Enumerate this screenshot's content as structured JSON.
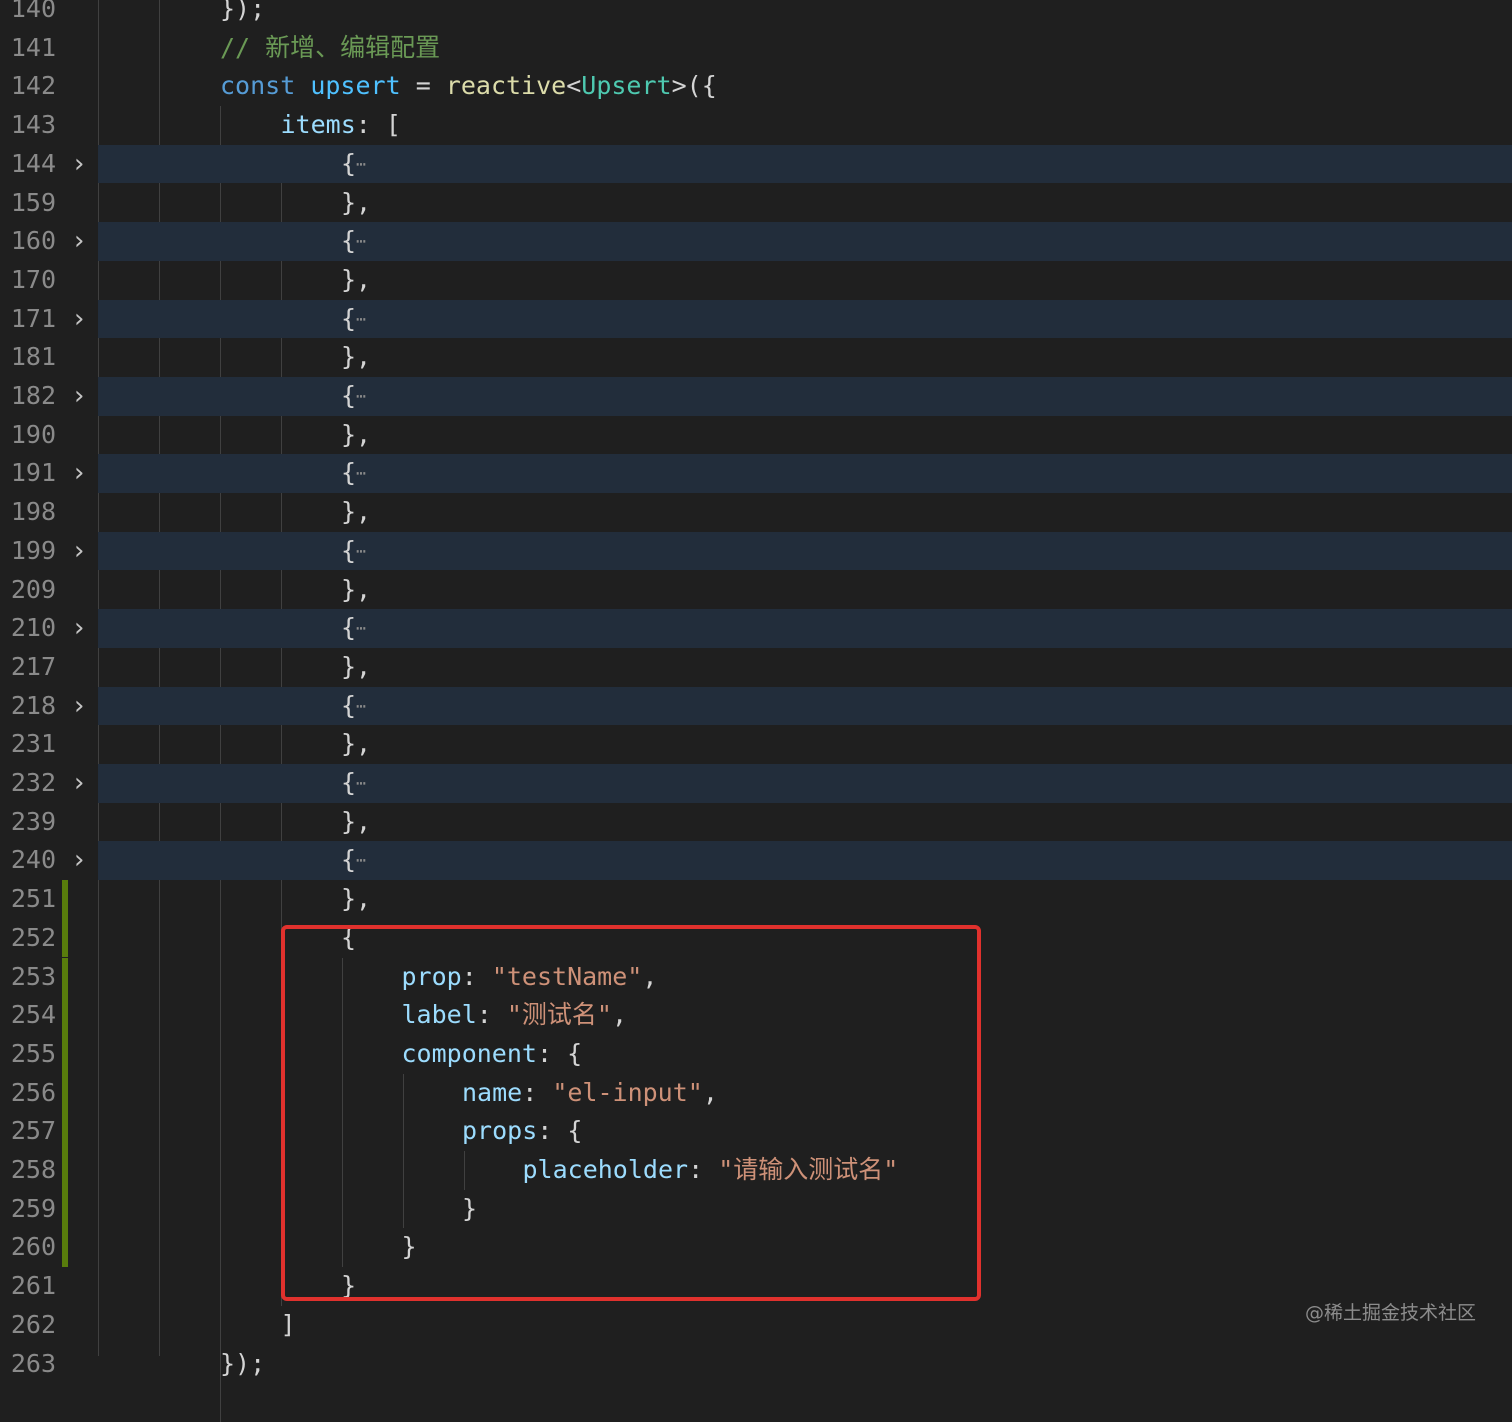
{
  "editor": {
    "lines": [
      {
        "num": "140",
        "indent": 0,
        "folded": false,
        "modified": false,
        "tokens": [
          {
            "t": "});",
            "c": "punc"
          }
        ]
      },
      {
        "num": "141",
        "indent": 0,
        "folded": false,
        "modified": false,
        "tokens": [
          {
            "t": "// 新增、编辑配置",
            "c": "comment"
          }
        ]
      },
      {
        "num": "142",
        "indent": 0,
        "folded": false,
        "modified": false,
        "tokens": [
          {
            "t": "const",
            "c": "kw"
          },
          {
            "t": " ",
            "c": "punc"
          },
          {
            "t": "upsert",
            "c": "var"
          },
          {
            "t": " = ",
            "c": "punc"
          },
          {
            "t": "reactive",
            "c": "fn"
          },
          {
            "t": "<",
            "c": "punc"
          },
          {
            "t": "Upsert",
            "c": "type"
          },
          {
            "t": ">({",
            "c": "punc"
          }
        ]
      },
      {
        "num": "143",
        "indent": 1,
        "folded": false,
        "modified": false,
        "tokens": [
          {
            "t": "items",
            "c": "prop"
          },
          {
            "t": ": [",
            "c": "punc"
          }
        ]
      },
      {
        "num": "144",
        "indent": 2,
        "folded": true,
        "modified": false,
        "tokens": [
          {
            "t": "{",
            "c": "punc"
          },
          {
            "t": "⋯",
            "c": "dots"
          }
        ]
      },
      {
        "num": "159",
        "indent": 2,
        "folded": false,
        "modified": false,
        "tokens": [
          {
            "t": "},",
            "c": "punc"
          }
        ]
      },
      {
        "num": "160",
        "indent": 2,
        "folded": true,
        "modified": false,
        "tokens": [
          {
            "t": "{",
            "c": "punc"
          },
          {
            "t": "⋯",
            "c": "dots"
          }
        ]
      },
      {
        "num": "170",
        "indent": 2,
        "folded": false,
        "modified": false,
        "tokens": [
          {
            "t": "},",
            "c": "punc"
          }
        ]
      },
      {
        "num": "171",
        "indent": 2,
        "folded": true,
        "modified": false,
        "tokens": [
          {
            "t": "{",
            "c": "punc"
          },
          {
            "t": "⋯",
            "c": "dots"
          }
        ]
      },
      {
        "num": "181",
        "indent": 2,
        "folded": false,
        "modified": false,
        "tokens": [
          {
            "t": "},",
            "c": "punc"
          }
        ]
      },
      {
        "num": "182",
        "indent": 2,
        "folded": true,
        "modified": false,
        "tokens": [
          {
            "t": "{",
            "c": "punc"
          },
          {
            "t": "⋯",
            "c": "dots"
          }
        ]
      },
      {
        "num": "190",
        "indent": 2,
        "folded": false,
        "modified": false,
        "tokens": [
          {
            "t": "},",
            "c": "punc"
          }
        ]
      },
      {
        "num": "191",
        "indent": 2,
        "folded": true,
        "modified": false,
        "tokens": [
          {
            "t": "{",
            "c": "punc"
          },
          {
            "t": "⋯",
            "c": "dots"
          }
        ]
      },
      {
        "num": "198",
        "indent": 2,
        "folded": false,
        "modified": false,
        "tokens": [
          {
            "t": "},",
            "c": "punc"
          }
        ]
      },
      {
        "num": "199",
        "indent": 2,
        "folded": true,
        "modified": false,
        "tokens": [
          {
            "t": "{",
            "c": "punc"
          },
          {
            "t": "⋯",
            "c": "dots"
          }
        ]
      },
      {
        "num": "209",
        "indent": 2,
        "folded": false,
        "modified": false,
        "tokens": [
          {
            "t": "},",
            "c": "punc"
          }
        ]
      },
      {
        "num": "210",
        "indent": 2,
        "folded": true,
        "modified": false,
        "tokens": [
          {
            "t": "{",
            "c": "punc"
          },
          {
            "t": "⋯",
            "c": "dots"
          }
        ]
      },
      {
        "num": "217",
        "indent": 2,
        "folded": false,
        "modified": false,
        "tokens": [
          {
            "t": "},",
            "c": "punc"
          }
        ]
      },
      {
        "num": "218",
        "indent": 2,
        "folded": true,
        "modified": false,
        "tokens": [
          {
            "t": "{",
            "c": "punc"
          },
          {
            "t": "⋯",
            "c": "dots"
          }
        ]
      },
      {
        "num": "231",
        "indent": 2,
        "folded": false,
        "modified": false,
        "tokens": [
          {
            "t": "},",
            "c": "punc"
          }
        ]
      },
      {
        "num": "232",
        "indent": 2,
        "folded": true,
        "modified": false,
        "tokens": [
          {
            "t": "{",
            "c": "punc"
          },
          {
            "t": "⋯",
            "c": "dots"
          }
        ]
      },
      {
        "num": "239",
        "indent": 2,
        "folded": false,
        "modified": false,
        "tokens": [
          {
            "t": "},",
            "c": "punc"
          }
        ]
      },
      {
        "num": "240",
        "indent": 2,
        "folded": true,
        "modified": false,
        "tokens": [
          {
            "t": "{",
            "c": "punc"
          },
          {
            "t": "⋯",
            "c": "dots"
          }
        ]
      },
      {
        "num": "251",
        "indent": 2,
        "folded": false,
        "modified": true,
        "tokens": [
          {
            "t": "},",
            "c": "punc"
          }
        ]
      },
      {
        "num": "252",
        "indent": 2,
        "folded": false,
        "modified": true,
        "tokens": [
          {
            "t": "{",
            "c": "punc"
          }
        ]
      },
      {
        "num": "253",
        "indent": 3,
        "folded": false,
        "modified": true,
        "tokens": [
          {
            "t": "prop",
            "c": "prop"
          },
          {
            "t": ": ",
            "c": "punc"
          },
          {
            "t": "\"testName\"",
            "c": "str"
          },
          {
            "t": ",",
            "c": "punc"
          }
        ]
      },
      {
        "num": "254",
        "indent": 3,
        "folded": false,
        "modified": true,
        "tokens": [
          {
            "t": "label",
            "c": "prop"
          },
          {
            "t": ": ",
            "c": "punc"
          },
          {
            "t": "\"测试名\"",
            "c": "str"
          },
          {
            "t": ",",
            "c": "punc"
          }
        ]
      },
      {
        "num": "255",
        "indent": 3,
        "folded": false,
        "modified": true,
        "tokens": [
          {
            "t": "component",
            "c": "prop"
          },
          {
            "t": ": {",
            "c": "punc"
          }
        ]
      },
      {
        "num": "256",
        "indent": 4,
        "folded": false,
        "modified": true,
        "tokens": [
          {
            "t": "name",
            "c": "prop"
          },
          {
            "t": ": ",
            "c": "punc"
          },
          {
            "t": "\"el-input\"",
            "c": "str"
          },
          {
            "t": ",",
            "c": "punc"
          }
        ]
      },
      {
        "num": "257",
        "indent": 4,
        "folded": false,
        "modified": true,
        "tokens": [
          {
            "t": "props",
            "c": "prop"
          },
          {
            "t": ": {",
            "c": "punc"
          }
        ]
      },
      {
        "num": "258",
        "indent": 5,
        "folded": false,
        "modified": true,
        "tokens": [
          {
            "t": "placeholder",
            "c": "prop"
          },
          {
            "t": ": ",
            "c": "punc"
          },
          {
            "t": "\"请输入测试名\"",
            "c": "str"
          }
        ]
      },
      {
        "num": "259",
        "indent": 4,
        "folded": false,
        "modified": true,
        "tokens": [
          {
            "t": "}",
            "c": "punc"
          }
        ]
      },
      {
        "num": "260",
        "indent": 3,
        "folded": false,
        "modified": true,
        "tokens": [
          {
            "t": "}",
            "c": "punc"
          }
        ]
      },
      {
        "num": "261",
        "indent": 2,
        "folded": false,
        "modified": false,
        "tokens": [
          {
            "t": "}",
            "c": "punc"
          }
        ]
      },
      {
        "num": "262",
        "indent": 1,
        "folded": false,
        "modified": false,
        "tokens": [
          {
            "t": "]",
            "c": "punc"
          }
        ]
      },
      {
        "num": "263",
        "indent": 0,
        "folded": false,
        "modified": false,
        "tokens": [
          {
            "t": "});",
            "c": "punc"
          }
        ]
      }
    ]
  },
  "annotation": {
    "color": "#e0312d"
  },
  "watermark": {
    "text": "@稀土掘金技术社区"
  },
  "icons": {
    "fold": "chevron-right-icon"
  }
}
